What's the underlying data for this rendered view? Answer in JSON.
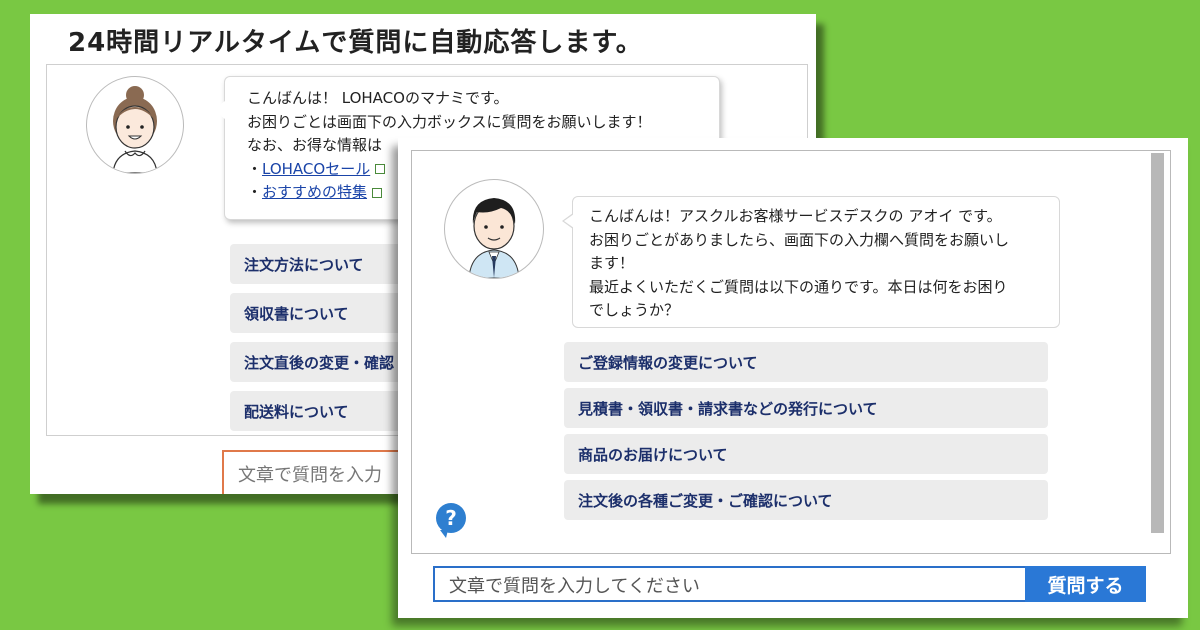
{
  "back_window": {
    "title": "24時間リアルタイムで質問に自動応答します。",
    "bubble": {
      "line1": "こんばんは！ LOHACOのマナミです。",
      "line2": "お困りごとは画面下の入力ボックスに質問をお願いします！",
      "line3": "なお、お得な情報は",
      "bullet": "・",
      "link1": "LOHACOセール",
      "link2": "おすすめの特集"
    },
    "buttons": [
      "注文方法について",
      "領収書について",
      "注文直後の変更・確認",
      "配送料について"
    ],
    "input_placeholder": "文章で質問を入力"
  },
  "front_window": {
    "bubble": {
      "line1": "こんばんは！アスクルお客様サービスデスクの アオイ です。",
      "line2": "お困りごとがありましたら、画面下の入力欄へ質問をお願いし",
      "line3": "ます！",
      "line4": "最近よくいただくご質問は以下の通りです。本日は何をお困り",
      "line5": "でしょうか？"
    },
    "buttons": [
      "ご登録情報の変更について",
      "見積書・領収書・請求書などの発行について",
      "商品のお届けについて",
      "注文後の各種ご変更・ご確認について"
    ],
    "help_icon_glyph": "?",
    "input_placeholder": "文章で質問を入力してください",
    "submit_label": "質問する"
  },
  "colors": {
    "background": "#79c843",
    "button_text": "#1c2f6b",
    "link": "#1a44a8",
    "accent_blue": "#2a78d6",
    "back_input_border": "#e0794a"
  },
  "icons": [
    "female-operator-avatar",
    "male-operator-avatar",
    "help-question-icon",
    "external-link-icon"
  ]
}
